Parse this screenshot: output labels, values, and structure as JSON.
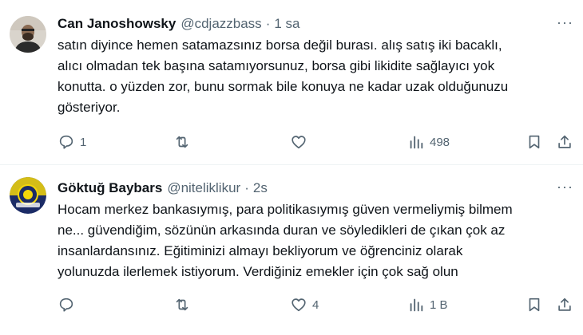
{
  "tweets": [
    {
      "name": "Can Janoshowsky",
      "handle": "@cdjazzbass",
      "separator": "·",
      "time": "1 sa",
      "more": "···",
      "lines": [
        "satın diyince hemen satamazsınız borsa değil burası. alış satış iki bacaklı,",
        "alıcı olmadan tek başına satamıyorsunuz, borsa gibi likidite sağlayıcı yok",
        "konutta. o yüzden zor, bunu sormak bile konuya ne kadar uzak olduğunuzu",
        "gösteriyor."
      ],
      "replies": "1",
      "retweets": "",
      "likes": "",
      "views": "498"
    },
    {
      "name": "Göktuğ Baybars",
      "handle": "@niteliklikur",
      "separator": "·",
      "time": "2s",
      "more": "···",
      "lines": [
        "Hocam merkez bankasıymış, para politikasıymış güven vermeliymiş bilmem",
        "ne... güvendiğim, sözünün arkasında duran ve söyledikleri de çıkan çok az",
        "insanlardansınız. Eğitiminizi almayı bekliyorum ve öğrenciniz olarak",
        "yolunuzda ilerlemek istiyorum. Verdiğiniz emekler için çok sağ olun"
      ],
      "replies": "",
      "retweets": "",
      "likes": "4",
      "views": "1 B"
    }
  ],
  "colors": {
    "text": "#0f1419",
    "secondary": "#536471",
    "divider": "#eff3f4"
  },
  "icons": [
    "reply-icon",
    "retweet-icon",
    "like-icon",
    "views-icon",
    "bookmark-icon",
    "share-icon",
    "more-icon"
  ]
}
